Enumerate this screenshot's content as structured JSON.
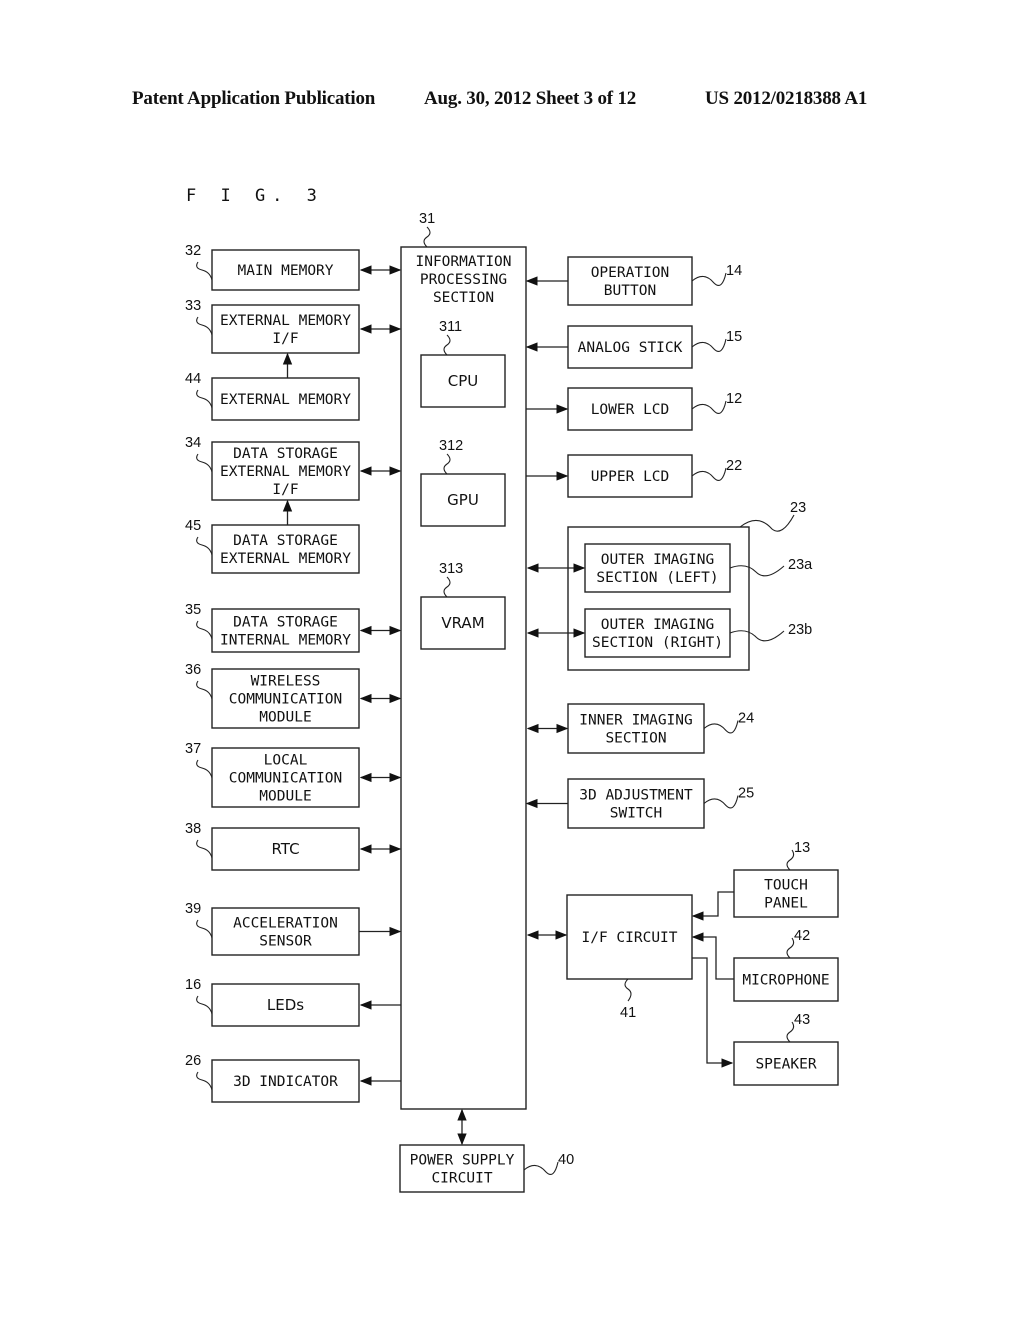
{
  "header": {
    "left": "Patent Application Publication",
    "date_sheet": "Aug. 30, 2012  Sheet 3 of 12",
    "number": "US 2012/0218388 A1"
  },
  "figure_label": "F I G. 3",
  "central": {
    "ref": "31",
    "lines": [
      "INFORMATION",
      "PROCESSING",
      "SECTION"
    ],
    "inner": [
      {
        "ref": "311",
        "label": "CPU"
      },
      {
        "ref": "312",
        "label": "GPU"
      },
      {
        "ref": "313",
        "label": "VRAM"
      }
    ]
  },
  "left_blocks": [
    {
      "ref": "32",
      "lines": [
        "MAIN MEMORY"
      ],
      "link": "bidirectional"
    },
    {
      "ref": "33",
      "lines": [
        "EXTERNAL MEMORY",
        "I/F"
      ],
      "link": "bidirectional"
    },
    {
      "ref": "44",
      "lines": [
        "EXTERNAL MEMORY"
      ],
      "link": "to-33"
    },
    {
      "ref": "34",
      "lines": [
        "DATA STORAGE",
        "EXTERNAL MEMORY",
        "I/F"
      ],
      "link": "bidirectional"
    },
    {
      "ref": "45",
      "lines": [
        "DATA STORAGE",
        "EXTERNAL MEMORY"
      ],
      "link": "to-34"
    },
    {
      "ref": "35",
      "lines": [
        "DATA STORAGE",
        "INTERNAL MEMORY"
      ],
      "link": "bidirectional"
    },
    {
      "ref": "36",
      "lines": [
        "WIRELESS",
        "COMMUNICATION",
        "MODULE"
      ],
      "link": "bidirectional"
    },
    {
      "ref": "37",
      "lines": [
        "LOCAL",
        "COMMUNICATION",
        "MODULE"
      ],
      "link": "bidirectional"
    },
    {
      "ref": "38",
      "lines": [
        "RTC"
      ],
      "link": "bidirectional"
    },
    {
      "ref": "39",
      "lines": [
        "ACCELERATION",
        "SENSOR"
      ],
      "link": "input"
    },
    {
      "ref": "16",
      "lines": [
        "LEDs"
      ],
      "link": "output"
    },
    {
      "ref": "26",
      "lines": [
        "3D INDICATOR"
      ],
      "link": "output"
    }
  ],
  "right_blocks": [
    {
      "ref": "14",
      "lines": [
        "OPERATION",
        "BUTTON"
      ],
      "link": "input"
    },
    {
      "ref": "15",
      "lines": [
        "ANALOG STICK"
      ],
      "link": "input"
    },
    {
      "ref": "12",
      "lines": [
        "LOWER LCD"
      ],
      "link": "output"
    },
    {
      "ref": "22",
      "lines": [
        "UPPER LCD"
      ],
      "link": "output"
    },
    {
      "ref": "24",
      "lines": [
        "INNER IMAGING",
        "SECTION"
      ],
      "link": "bidirectional"
    },
    {
      "ref": "25",
      "lines": [
        "3D ADJUSTMENT",
        "SWITCH"
      ],
      "link": "input"
    }
  ],
  "outer_imaging": {
    "ref": "23",
    "children": [
      {
        "ref": "23a",
        "lines": [
          "OUTER IMAGING",
          "SECTION (LEFT)"
        ],
        "link": "bidirectional"
      },
      {
        "ref": "23b",
        "lines": [
          "OUTER IMAGING",
          "SECTION (RIGHT)"
        ],
        "link": "bidirectional"
      }
    ]
  },
  "if_circuit": {
    "ref": "41",
    "label": "I/F CIRCUIT",
    "peripherals": [
      {
        "ref": "13",
        "lines": [
          "TOUCH",
          "PANEL"
        ],
        "link": "input"
      },
      {
        "ref": "42",
        "lines": [
          "MICROPHONE"
        ],
        "link": "input"
      },
      {
        "ref": "43",
        "lines": [
          "SPEAKER"
        ],
        "link": "output"
      }
    ]
  },
  "power": {
    "ref": "40",
    "lines": [
      "POWER SUPPLY",
      "CIRCUIT"
    ],
    "link": "bidirectional"
  }
}
